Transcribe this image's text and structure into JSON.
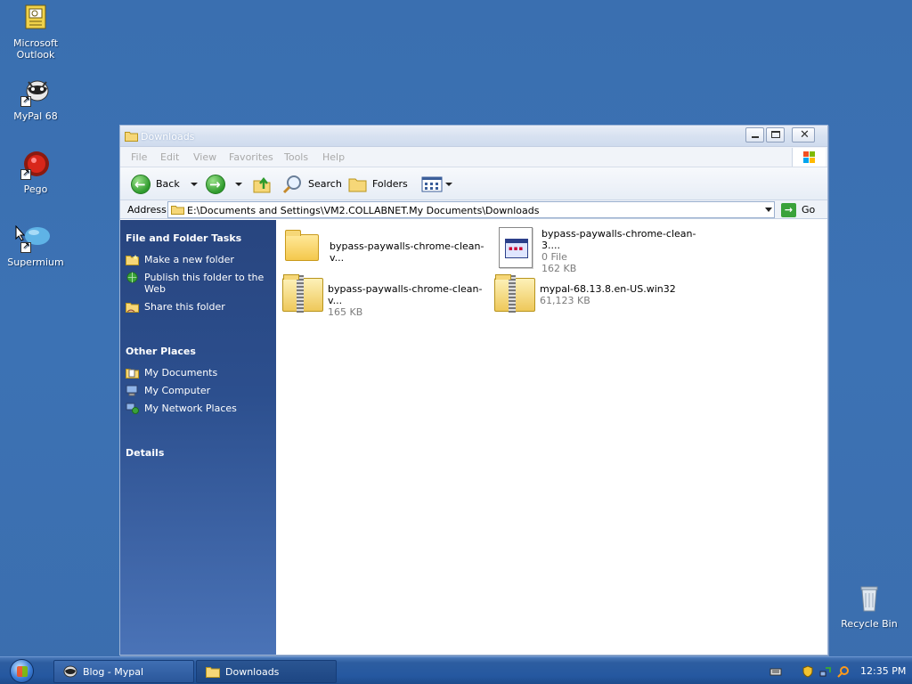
{
  "desktop": {
    "icons": [
      {
        "label": "Microsoft\nOutlook",
        "line1": "Microsoft",
        "line2": "Outlook"
      },
      {
        "label": "MyPal 68"
      },
      {
        "label": "Pego"
      },
      {
        "label": "Supermium"
      },
      {
        "label": "Recycle Bin"
      }
    ]
  },
  "window": {
    "title": "Downloads",
    "menu": [
      "File",
      "Edit",
      "View",
      "Favorites",
      "Tools",
      "Help"
    ],
    "toolbar": {
      "back": "Back",
      "search": "Search",
      "folders": "Folders"
    },
    "address": {
      "label": "Address",
      "path": "E:\\Documents and Settings\\VM2.COLLABNET.My Documents\\Downloads",
      "go": "Go"
    },
    "sidebar": {
      "file_folder_tasks": {
        "title": "File and Folder Tasks",
        "items": [
          "Make a new folder",
          "Publish this folder to the Web",
          "Share this folder"
        ]
      },
      "other_places": {
        "title": "Other Places",
        "items": [
          "My Documents",
          "My Computer",
          "My Network Places"
        ]
      },
      "details": {
        "title": "Details"
      }
    },
    "files": [
      {
        "name": "bypass-paywalls-chrome-clean-v...",
        "type": "folder",
        "line2": "",
        "line3": ""
      },
      {
        "name": "bypass-paywalls-chrome-clean-3....",
        "type": "app",
        "line2": "0 File",
        "line3": "162 KB"
      },
      {
        "name": "bypass-paywalls-chrome-clean-v...",
        "type": "zip",
        "line2": "165 KB",
        "line3": ""
      },
      {
        "name": "mypal-68.13.8.en-US.win32",
        "type": "zip",
        "line2": "61,123 KB",
        "line3": ""
      }
    ]
  },
  "taskbar": {
    "buttons": [
      "Blog - Mypal",
      "Downloads"
    ],
    "clock": "12:35 PM"
  },
  "colors": {
    "desktop": "#3b6eae",
    "sidebar": "#2c4f8e",
    "taskbar": "#2558a0"
  }
}
